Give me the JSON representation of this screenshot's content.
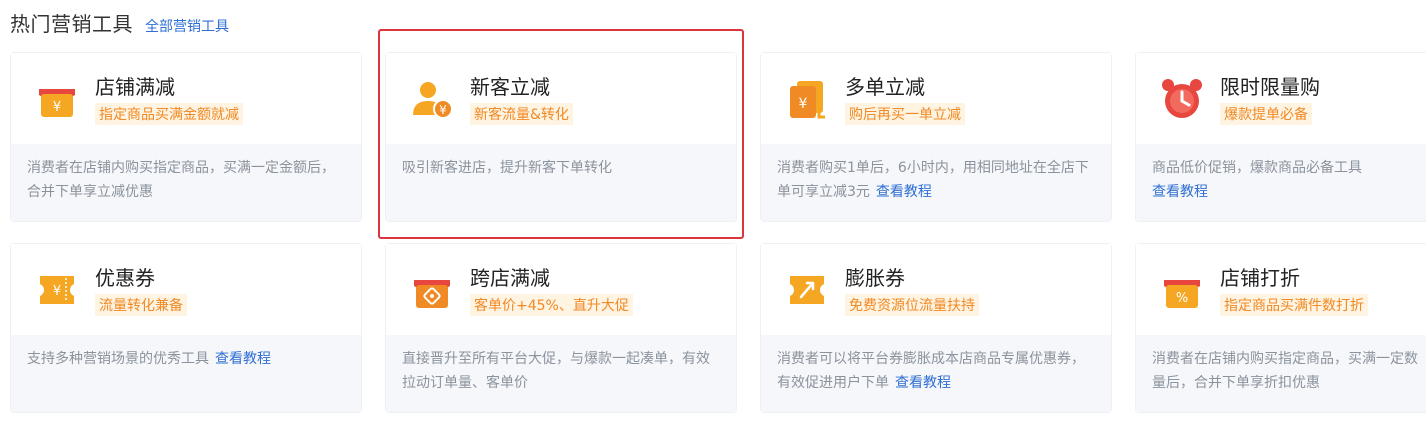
{
  "header": {
    "title": "热门营销工具",
    "all_link": "全部营销工具"
  },
  "colors": {
    "accent_blue": "#2f6fd3",
    "icon_orange": "#f5a623",
    "icon_red": "#e8473f",
    "subtitle_orange": "#f08a24",
    "highlight_red": "#d9363e"
  },
  "cards": [
    {
      "name": "店铺满减",
      "subtitle": "指定商品买满金额就减",
      "desc": "消费者在店铺内购买指定商品，买满一定金额后，合并下单享立减优惠",
      "tutorial": "",
      "icon": "shop-yen-icon"
    },
    {
      "name": "新客立减",
      "subtitle": "新客流量&转化",
      "desc": "吸引新客进店，提升新客下单转化",
      "tutorial": "",
      "icon": "new-customer-icon"
    },
    {
      "name": "多单立减",
      "subtitle": "购后再买一单立减",
      "desc": "消费者购买1单后，6小时内，用相同地址在全店下单可享立减3元",
      "tutorial": "查看教程",
      "icon": "multi-order-icon"
    },
    {
      "name": "限时限量购",
      "subtitle": "爆款提单必备",
      "desc": "商品低价促销，爆款商品必备工具",
      "tutorial": "查看教程",
      "icon": "alarm-clock-icon"
    },
    {
      "name": "优惠券",
      "subtitle": "流量转化兼备",
      "desc": "支持多种营销场景的优秀工具",
      "tutorial": "查看教程",
      "icon": "coupon-icon"
    },
    {
      "name": "跨店满减",
      "subtitle": "客单价+45%、直升大促",
      "desc": "直接晋升至所有平台大促，与爆款一起凑单，有效拉动订单量、客单价",
      "tutorial": "",
      "icon": "cross-shop-icon"
    },
    {
      "name": "膨胀券",
      "subtitle": "免费资源位流量扶持",
      "desc": "消费者可以将平台券膨胀成本店商品专属优惠券，有效促进用户下单",
      "tutorial": "查看教程",
      "icon": "expansion-coupon-icon"
    },
    {
      "name": "店铺打折",
      "subtitle": "指定商品买满件数打折",
      "desc": "消费者在店铺内购买指定商品，买满一定数量后，合并下单享折扣优惠",
      "tutorial": "",
      "icon": "shop-discount-icon"
    }
  ]
}
